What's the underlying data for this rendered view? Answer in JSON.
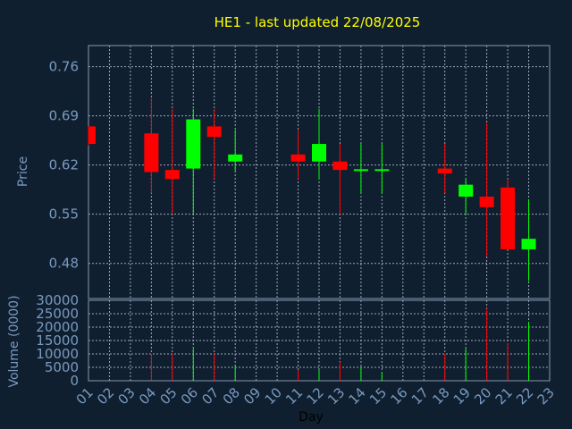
{
  "chart_data": {
    "type": "candlestick",
    "title": "HE1 - last updated 22/08/2025",
    "ylabel": "Price",
    "volume_label": "Volume (0000)",
    "xlabel": "Day",
    "x_ticks": [
      "01",
      "02",
      "03",
      "04",
      "05",
      "06",
      "07",
      "08",
      "09",
      "10",
      "11",
      "12",
      "13",
      "14",
      "15",
      "16",
      "17",
      "18",
      "19",
      "20",
      "21",
      "22",
      "23"
    ],
    "price_ticks": [
      "0.76",
      "0.69",
      "0.62",
      "0.55",
      "0.48"
    ],
    "price_tick_values": [
      0.76,
      0.69,
      0.62,
      0.55,
      0.48
    ],
    "ylim": [
      0.43,
      0.79
    ],
    "volume_ticks": [
      "30000",
      "25000",
      "20000",
      "15000",
      "10000",
      "5000",
      "0"
    ],
    "volume_tick_values": [
      30000,
      25000,
      20000,
      15000,
      10000,
      5000,
      0
    ],
    "volume_ylim": [
      0,
      30000
    ],
    "grid": true,
    "colors": {
      "up": "#00ff00",
      "down": "#ff0000",
      "title": "#ffff00",
      "axis_text": "#7a9ac0",
      "background": "#0f1f2f"
    },
    "candles": [
      {
        "day": 1,
        "open": 0.675,
        "high": 0.675,
        "low": 0.648,
        "close": 0.65,
        "volume": 0
      },
      {
        "day": 4,
        "open": 0.665,
        "high": 0.715,
        "low": 0.58,
        "close": 0.61,
        "volume": 10000
      },
      {
        "day": 5,
        "open": 0.613,
        "high": 0.7,
        "low": 0.55,
        "close": 0.6,
        "volume": 10000
      },
      {
        "day": 6,
        "open": 0.615,
        "high": 0.7,
        "low": 0.55,
        "close": 0.685,
        "volume": 12000
      },
      {
        "day": 7,
        "open": 0.675,
        "high": 0.7,
        "low": 0.6,
        "close": 0.66,
        "volume": 10000
      },
      {
        "day": 8,
        "open": 0.625,
        "high": 0.67,
        "low": 0.61,
        "close": 0.635,
        "volume": 6000
      },
      {
        "day": 11,
        "open": 0.635,
        "high": 0.67,
        "low": 0.6,
        "close": 0.625,
        "volume": 4000
      },
      {
        "day": 12,
        "open": 0.625,
        "high": 0.7,
        "low": 0.6,
        "close": 0.65,
        "volume": 4000
      },
      {
        "day": 13,
        "open": 0.625,
        "high": 0.65,
        "low": 0.55,
        "close": 0.613,
        "volume": 7000
      },
      {
        "day": 14,
        "open": 0.612,
        "high": 0.65,
        "low": 0.58,
        "close": 0.614,
        "volume": 5000
      },
      {
        "day": 15,
        "open": 0.612,
        "high": 0.65,
        "low": 0.58,
        "close": 0.614,
        "volume": 3000
      },
      {
        "day": 18,
        "open": 0.615,
        "high": 0.65,
        "low": 0.58,
        "close": 0.608,
        "volume": 10000
      },
      {
        "day": 19,
        "open": 0.575,
        "high": 0.6,
        "low": 0.55,
        "close": 0.592,
        "volume": 12000
      },
      {
        "day": 20,
        "open": 0.575,
        "high": 0.68,
        "low": 0.49,
        "close": 0.56,
        "volume": 27000
      },
      {
        "day": 21,
        "open": 0.588,
        "high": 0.6,
        "low": 0.5,
        "close": 0.5,
        "volume": 14000
      },
      {
        "day": 22,
        "open": 0.5,
        "high": 0.57,
        "low": 0.455,
        "close": 0.515,
        "volume": 22000
      }
    ]
  }
}
